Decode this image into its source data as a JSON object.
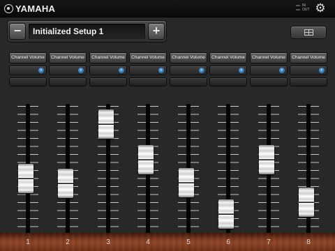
{
  "app": {
    "brand": "YAMAHA",
    "midi_in_label": "IN",
    "midi_out_label": "OUT"
  },
  "setup": {
    "name": "Initialized Setup 1",
    "prev_label": "−",
    "next_label": "+"
  },
  "channels": [
    {
      "number": "1",
      "label": "Channel Volume",
      "fader_level": 0.43
    },
    {
      "number": "2",
      "label": "Channel Volume",
      "fader_level": 0.38
    },
    {
      "number": "3",
      "label": "Channel Volume",
      "fader_level": 0.95
    },
    {
      "number": "4",
      "label": "Channel Volume",
      "fader_level": 0.61
    },
    {
      "number": "5",
      "label": "Channel Volume",
      "fader_level": 0.39
    },
    {
      "number": "6",
      "label": "Channel Volume",
      "fader_level": 0.09
    },
    {
      "number": "7",
      "label": "Channel Volume",
      "fader_level": 0.61
    },
    {
      "number": "8",
      "label": "Channel Volume",
      "fader_level": 0.2
    }
  ],
  "colors": {
    "accent_arrow": "#2f7fc4",
    "wood": "#7d3a1f"
  },
  "icons": {
    "settings": "gear-icon",
    "layout": "grid-layout-icon",
    "select": "chevron-right-icon"
  }
}
